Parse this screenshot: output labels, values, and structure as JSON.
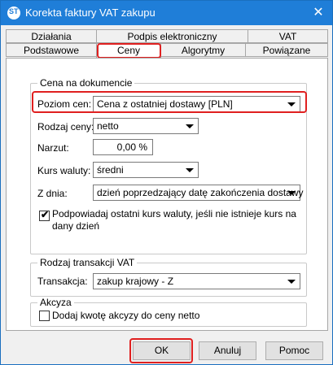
{
  "window": {
    "title": "Korekta faktury VAT zakupu",
    "logo_text": "ST",
    "close_symbol": "✕"
  },
  "tabs": {
    "row1": [
      "Działania",
      "Podpis elektroniczny",
      "VAT"
    ],
    "row2": [
      "Podstawowe",
      "Ceny",
      "Algorytmy",
      "Powiązane"
    ],
    "active": "Ceny"
  },
  "price_group": {
    "title": "Cena na dokumencie",
    "price_level": {
      "label": "Poziom cen:",
      "value": "Cena z ostatniej dostawy [PLN]"
    },
    "price_type": {
      "label": "Rodzaj ceny:",
      "value": "netto"
    },
    "markup": {
      "label": "Narzut:",
      "value": "0,00 %"
    },
    "exchange_rate": {
      "label": "Kurs waluty:",
      "value": "średni"
    },
    "from_date": {
      "label": "Z dnia:",
      "value": "dzień poprzedzający datę zakończenia dostawy"
    },
    "suggest_rate": {
      "checked": true,
      "label_line1": "Podpowiadaj ostatni kurs waluty, jeśli nie istnieje kurs na",
      "label_line2": "dany dzień"
    }
  },
  "vat_group": {
    "title": "Rodzaj transakcji VAT",
    "transaction": {
      "label": "Transakcja:",
      "value": "zakup krajowy - Z"
    }
  },
  "excise_group": {
    "title": "Akcyza",
    "add_excise": {
      "checked": false,
      "label": "Dodaj kwotę akcyzy do ceny netto"
    }
  },
  "buttons": {
    "ok": "OK",
    "cancel": "Anuluj",
    "help": "Pomoc"
  },
  "icons": {
    "check": "✔"
  }
}
